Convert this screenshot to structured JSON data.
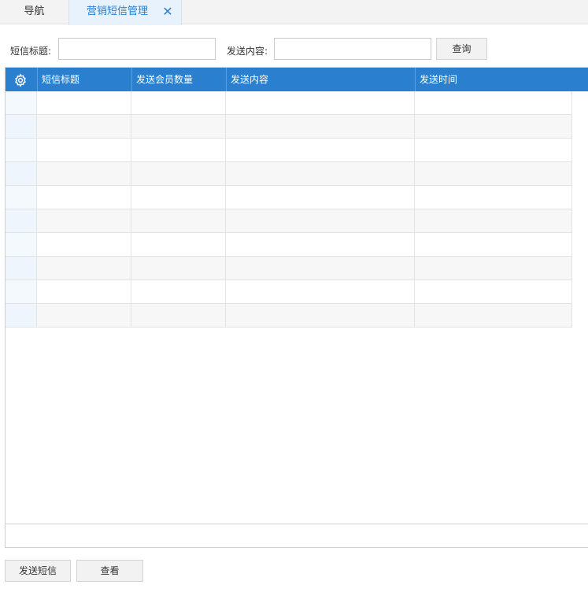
{
  "tabs": {
    "nav_label": "导航",
    "active_label": "营销短信管理",
    "close_glyph": "✕"
  },
  "search": {
    "title_label": "短信标题:",
    "title_value": "",
    "content_label": "发送内容:",
    "content_value": "",
    "query_button": "查询"
  },
  "grid": {
    "columns": [
      "短信标题",
      "发送会员数量",
      "发送内容",
      "发送时间"
    ],
    "settings_icon": "gear-icon",
    "header_color": "#2a7fce",
    "rows": [
      {
        "title": "",
        "member_count": "",
        "content": "",
        "send_time": ""
      },
      {
        "title": "",
        "member_count": "",
        "content": "",
        "send_time": ""
      },
      {
        "title": "",
        "member_count": "",
        "content": "",
        "send_time": ""
      },
      {
        "title": "",
        "member_count": "",
        "content": "",
        "send_time": ""
      },
      {
        "title": "",
        "member_count": "",
        "content": "",
        "send_time": ""
      },
      {
        "title": "",
        "member_count": "",
        "content": "",
        "send_time": ""
      },
      {
        "title": "",
        "member_count": "",
        "content": "",
        "send_time": ""
      },
      {
        "title": "",
        "member_count": "",
        "content": "",
        "send_time": ""
      },
      {
        "title": "",
        "member_count": "",
        "content": "",
        "send_time": ""
      },
      {
        "title": "",
        "member_count": "",
        "content": "",
        "send_time": ""
      }
    ]
  },
  "actions": {
    "send_button": "发送短信",
    "view_button": "查看"
  }
}
